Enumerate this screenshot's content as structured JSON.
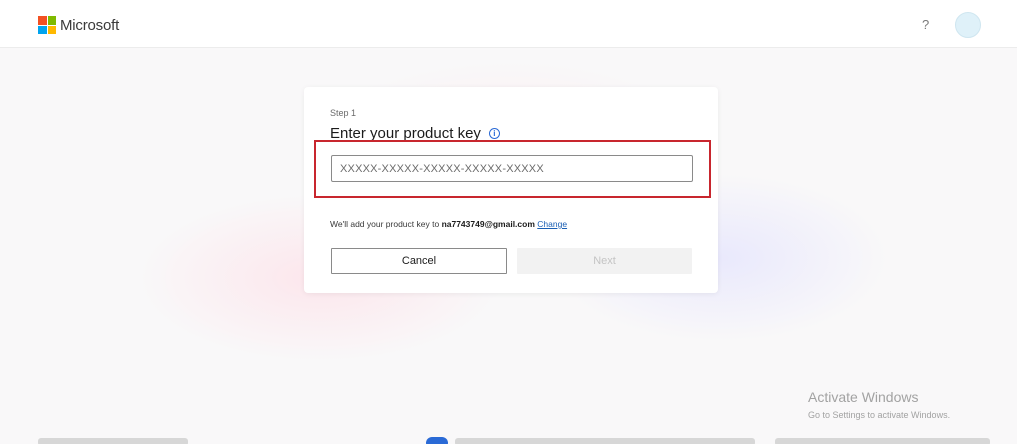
{
  "header": {
    "brand": "Microsoft",
    "help": "?",
    "logo_colors": [
      "#f25022",
      "#7fba00",
      "#00a4ef",
      "#ffb900"
    ]
  },
  "card": {
    "step": "Step 1",
    "title": "Enter your product key",
    "info_glyph": "i",
    "key_input": {
      "value": "",
      "placeholder": "XXXXX-XXXXX-XXXXX-XXXXX-XXXXX"
    },
    "notice_prefix": "We'll add your product key to ",
    "email": "na7743749@gmail.com",
    "change_link": "Change",
    "cancel_label": "Cancel",
    "next_label": "Next"
  },
  "highlight_color": "#c8262e",
  "watermark": {
    "title": "Activate Windows",
    "subtitle": "Go to Settings to activate Windows."
  }
}
